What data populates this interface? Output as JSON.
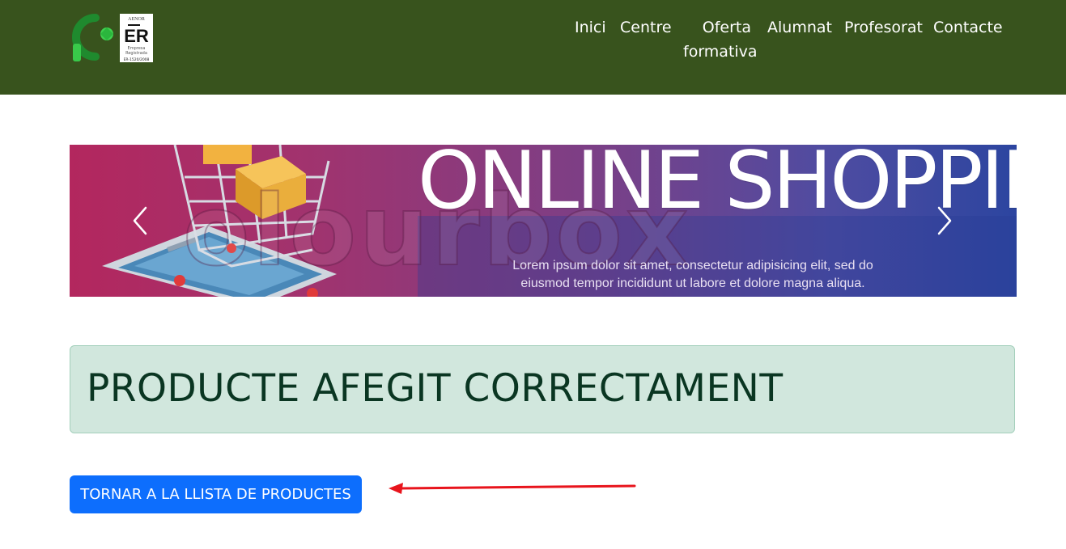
{
  "header": {
    "background_color": "#38531d",
    "logo": {
      "badge_top": "AENOR",
      "badge_main": "ER",
      "badge_line1": "Empresa",
      "badge_line2": "Registrada",
      "badge_code": "ER-1520/2008"
    },
    "nav": {
      "inici": "Inici",
      "centre": "Centre",
      "oferta_line1": "Oferta",
      "oferta_line2": "formativa",
      "alumnat": "Alumnat",
      "profesorat": "Profesorat",
      "contacte": "Contacte"
    }
  },
  "carousel": {
    "title": "ONLINE SHOPPING",
    "caption_line1": "Lorem ipsum dolor sit amet, consectetur adipisicing elit, sed do",
    "caption_line2": "eiusmod tempor incididunt ut labore et dolore magna aliqua.",
    "prev_icon": "chevron-left-icon",
    "next_icon": "chevron-right-icon"
  },
  "alert": {
    "message": "PRODUCTE AFEGIT CORRECTAMENT",
    "background_color": "#d1e7dd"
  },
  "actions": {
    "back_button_label": "TORNAR A LA LLISTA DE PRODUCTES",
    "button_color": "#0d6efd",
    "annotation_arrow_color": "#e8141c"
  }
}
